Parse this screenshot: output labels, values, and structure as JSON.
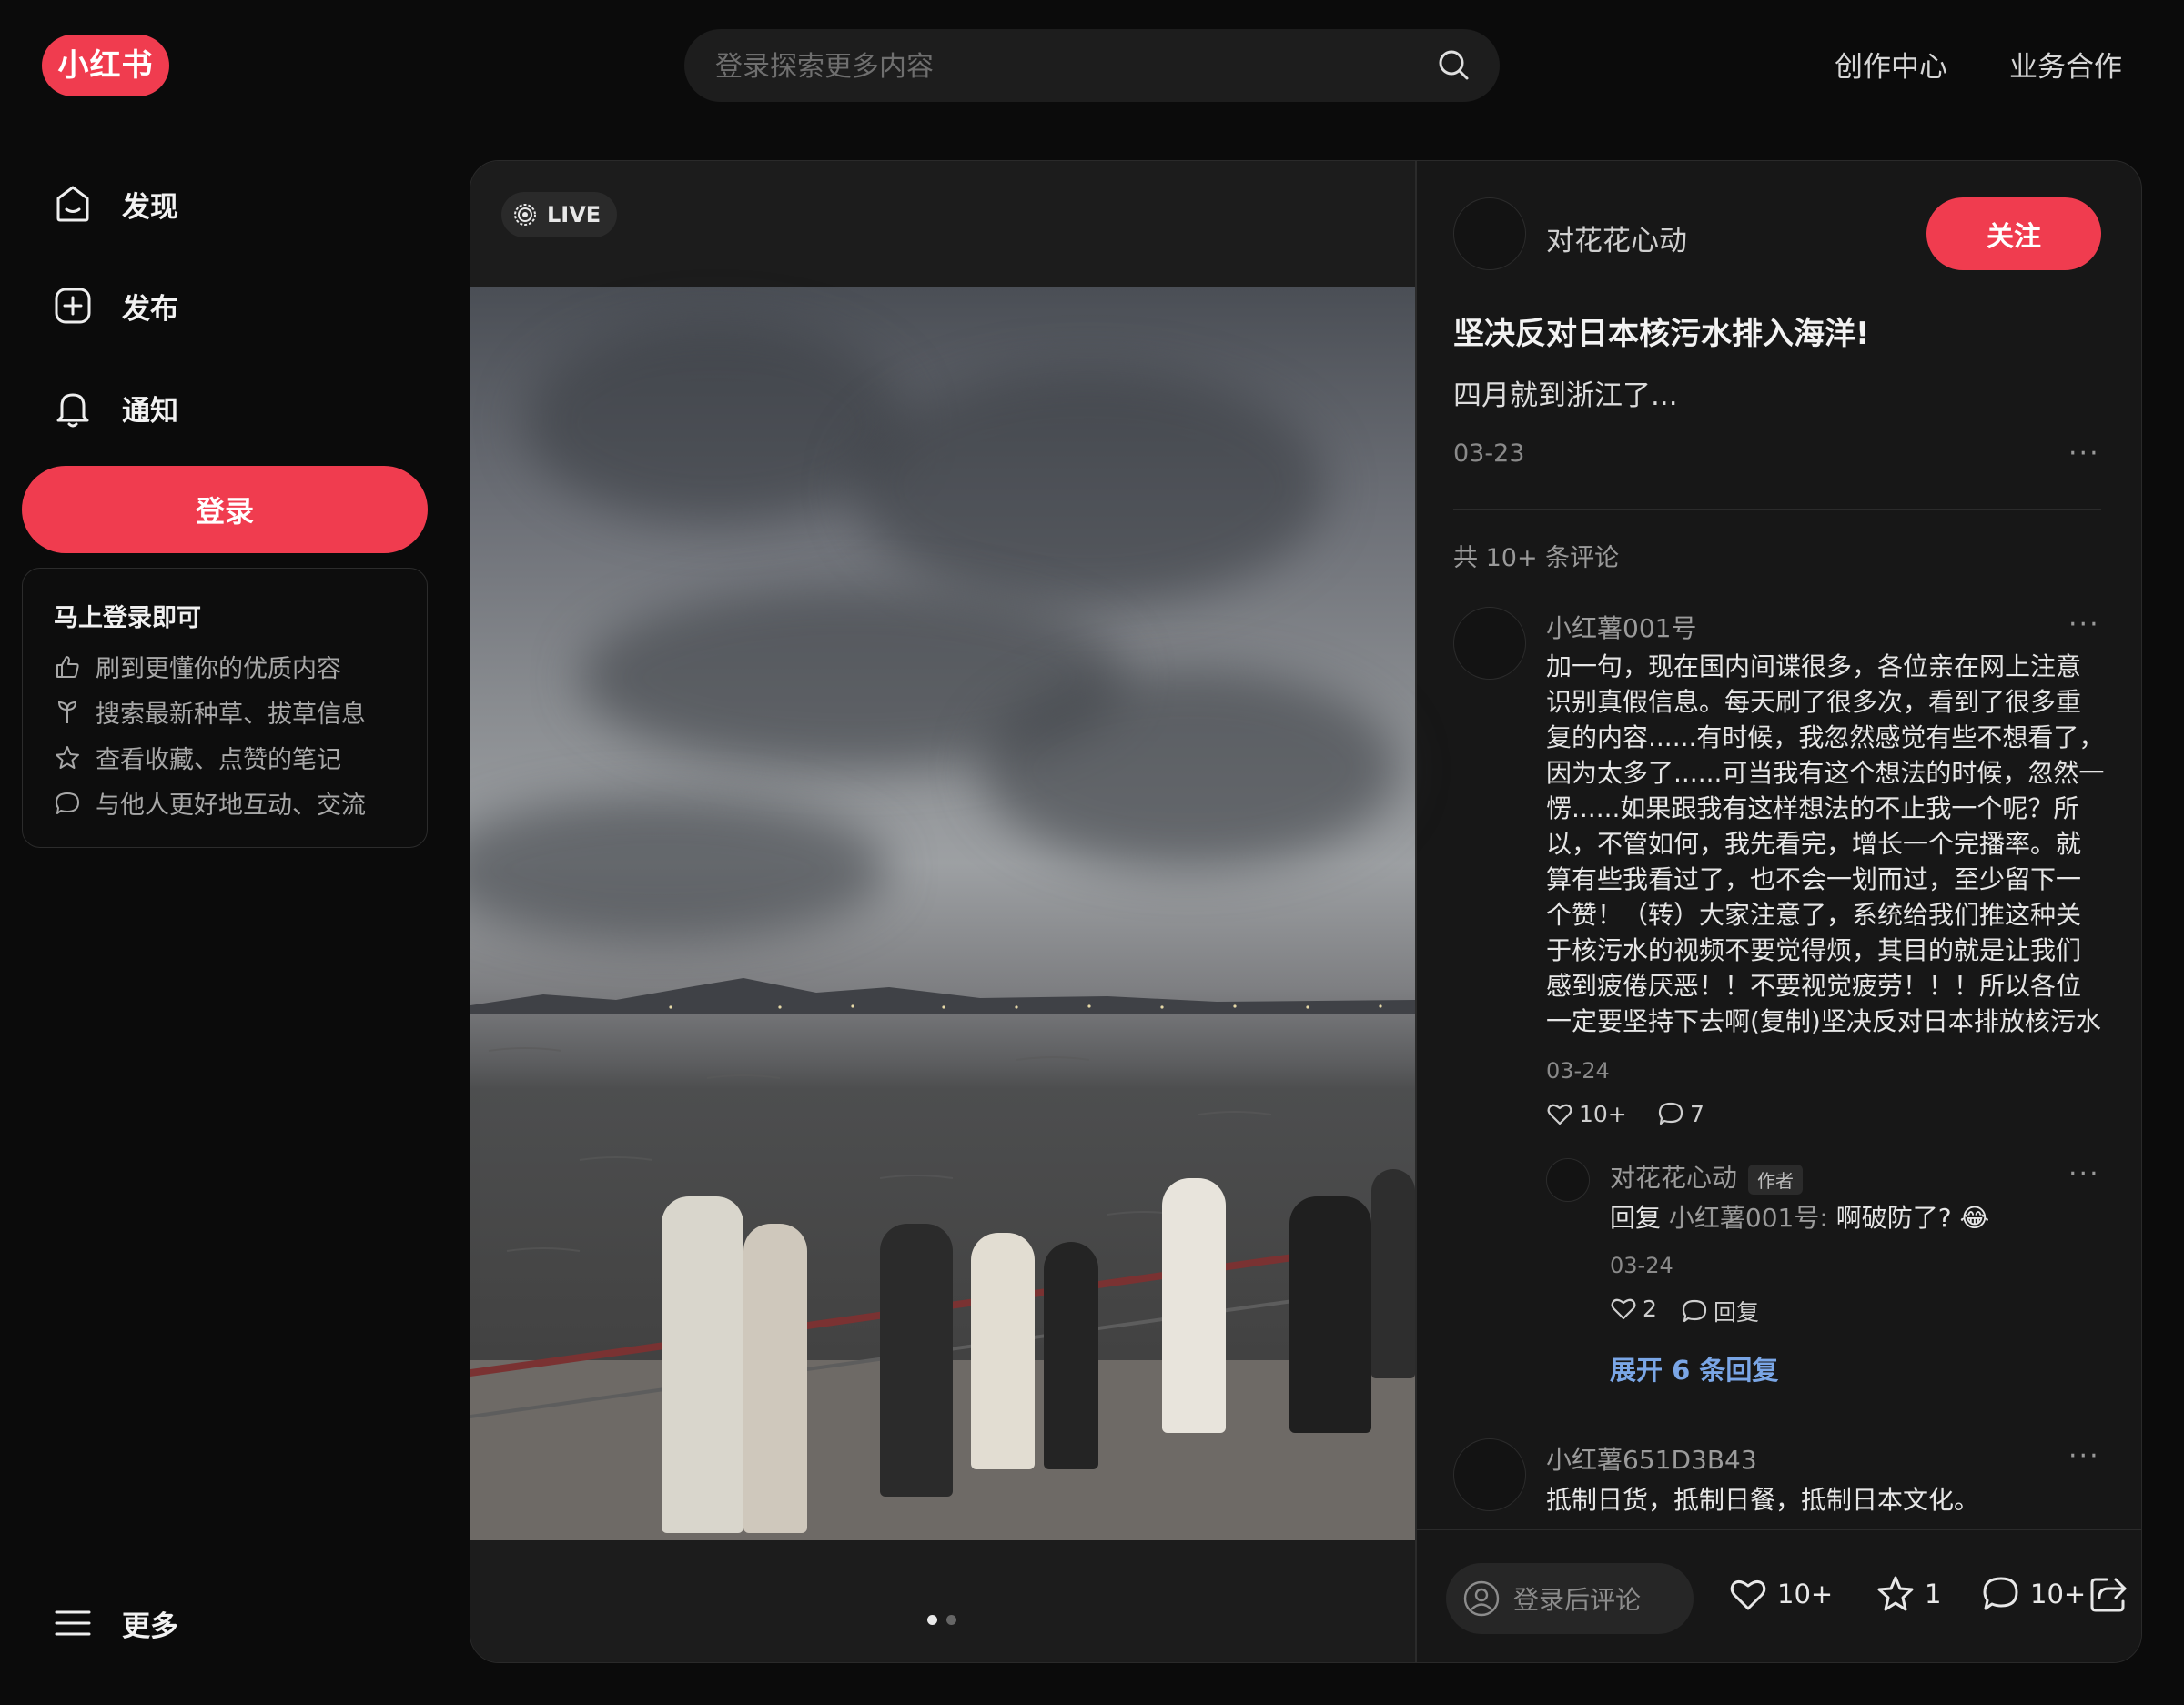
{
  "header": {
    "logo_text": "小红书",
    "search_placeholder": "登录探索更多内容",
    "links": [
      "创作中心",
      "业务合作"
    ]
  },
  "sidebar": {
    "items": [
      {
        "label": "发现",
        "icon": "discover-icon"
      },
      {
        "label": "发布",
        "icon": "publish-plus-icon"
      },
      {
        "label": "通知",
        "icon": "bell-icon"
      }
    ],
    "login_label": "登录",
    "promo": {
      "title": "马上登录即可",
      "items": [
        {
          "label": "刷到更懂你的优质内容",
          "icon": "thumbs-up-icon"
        },
        {
          "label": "搜索最新种草、拔草信息",
          "icon": "sprout-icon"
        },
        {
          "label": "查看收藏、点赞的笔记",
          "icon": "star-icon"
        },
        {
          "label": "与他人更好地互动、交流",
          "icon": "chat-bubble-icon"
        }
      ]
    },
    "more_label": "更多"
  },
  "note": {
    "live_badge": "LIVE",
    "image_page": {
      "current": 1,
      "total": 2
    },
    "author": "对花花心动",
    "follow_label": "关注",
    "title": "坚决反对日本核污水排入海洋!",
    "body": "四月就到浙江了...",
    "date": "03-23",
    "comment_count_text": "共 10+ 条评论"
  },
  "comments": [
    {
      "user": "小红薯001号",
      "lines": [
        "加一句，现在国内间谍很多，各位亲在网上注意",
        "识别真假信息。每天刷了很多次，看到了很多重",
        "复的内容......有时候，我忽然感觉有些不想看了，",
        "因为太多了......可当我有这个想法的时候，忽然一",
        "愣......如果跟我有这样想法的不止我一个呢？所",
        "以，不管如何，我先看完，增长一个完播率。就",
        "算有些我看过了，也不会一划而过，至少留下一",
        "个赞！（转）大家注意了，系统给我们推这种关",
        "于核污水的视频不要觉得烦，其目的就是让我们",
        "感到疲倦厌恶！！不要视觉疲劳！！！所以各位",
        "一定要坚持下去啊(复制)坚决反对日本排放核污水"
      ],
      "date": "03-24",
      "likes": "10+",
      "replies": "7",
      "reply": {
        "user": "对花花心动",
        "author_tag": "作者",
        "prefix": "回复",
        "quoted_user": "小红薯001号:",
        "text": "啊破防了? 😂",
        "date": "03-24",
        "likes": "2",
        "reply_label": "回复"
      },
      "expand_label": "展开 6 条回复"
    },
    {
      "user": "小红薯651D3B43",
      "text": "抵制日货，抵制日餐，抵制日本文化。"
    }
  ],
  "bottom_bar": {
    "comment_placeholder": "登录后评论",
    "likes": "10+",
    "collects": "1",
    "comments": "10+"
  },
  "colors": {
    "accent": "#f03c4f",
    "background": "#0b0b0b",
    "card": "#171717",
    "link_blue": "#7aa6e6"
  }
}
